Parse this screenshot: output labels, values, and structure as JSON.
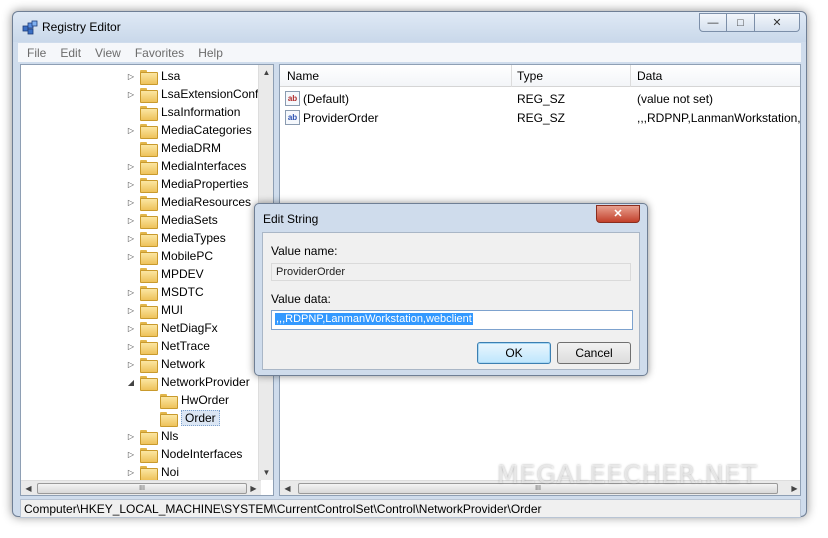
{
  "window": {
    "title": "Registry Editor",
    "controls": {
      "minimize": "—",
      "maximize": "□",
      "close": "✕"
    }
  },
  "menu": [
    "File",
    "Edit",
    "View",
    "Favorites",
    "Help"
  ],
  "tree": {
    "items": [
      {
        "label": "Lsa",
        "level": 0,
        "toggle": "▷"
      },
      {
        "label": "LsaExtensionConfi",
        "level": 0,
        "toggle": "▷"
      },
      {
        "label": "LsaInformation",
        "level": 0,
        "toggle": ""
      },
      {
        "label": "MediaCategories",
        "level": 0,
        "toggle": "▷"
      },
      {
        "label": "MediaDRM",
        "level": 0,
        "toggle": ""
      },
      {
        "label": "MediaInterfaces",
        "level": 0,
        "toggle": "▷"
      },
      {
        "label": "MediaProperties",
        "level": 0,
        "toggle": "▷"
      },
      {
        "label": "MediaResources",
        "level": 0,
        "toggle": "▷"
      },
      {
        "label": "MediaSets",
        "level": 0,
        "toggle": "▷"
      },
      {
        "label": "MediaTypes",
        "level": 0,
        "toggle": "▷"
      },
      {
        "label": "MobilePC",
        "level": 0,
        "toggle": "▷"
      },
      {
        "label": "MPDEV",
        "level": 0,
        "toggle": ""
      },
      {
        "label": "MSDTC",
        "level": 0,
        "toggle": "▷"
      },
      {
        "label": "MUI",
        "level": 0,
        "toggle": "▷"
      },
      {
        "label": "NetDiagFx",
        "level": 0,
        "toggle": "▷"
      },
      {
        "label": "NetTrace",
        "level": 0,
        "toggle": "▷"
      },
      {
        "label": "Network",
        "level": 0,
        "toggle": "▷"
      },
      {
        "label": "NetworkProvider",
        "level": 0,
        "toggle": "◢"
      },
      {
        "label": "HwOrder",
        "level": 1,
        "toggle": ""
      },
      {
        "label": "Order",
        "level": 1,
        "toggle": "",
        "selected": true
      },
      {
        "label": "Nls",
        "level": 0,
        "toggle": "▷"
      },
      {
        "label": "NodeInterfaces",
        "level": 0,
        "toggle": "▷"
      },
      {
        "label": "Noi",
        "level": 0,
        "toggle": "▷"
      }
    ],
    "scroll_up": "▲",
    "scroll_down": "▼",
    "scroll_left": "◀",
    "scroll_right": "▶",
    "thumb_grip": "III"
  },
  "list": {
    "columns": [
      "Name",
      "Type",
      "Data"
    ],
    "rows": [
      {
        "icon": "ab",
        "name": "(Default)",
        "type": "REG_SZ",
        "data": "(value not set)"
      },
      {
        "icon": "ab",
        "name": "ProviderOrder",
        "type": "REG_SZ",
        "data": ",,,RDPNP,LanmanWorkstation,v"
      }
    ],
    "scroll_left": "◀",
    "scroll_right": "▶",
    "thumb_grip": "III"
  },
  "status": "Computer\\HKEY_LOCAL_MACHINE\\SYSTEM\\CurrentControlSet\\Control\\NetworkProvider\\Order",
  "dialog": {
    "title": "Edit String",
    "close": "✕",
    "value_name_label": "Value name:",
    "value_name": "ProviderOrder",
    "value_data_label": "Value data:",
    "value_data": ",,,RDPNP,LanmanWorkstation,webclient",
    "ok_label": "OK",
    "cancel_label": "Cancel"
  },
  "watermark": "MEGALEECHER.NET",
  "colors": {
    "window_frame": "#cfdcec",
    "selection": "#3399ff",
    "close_button": "#c2402b"
  }
}
